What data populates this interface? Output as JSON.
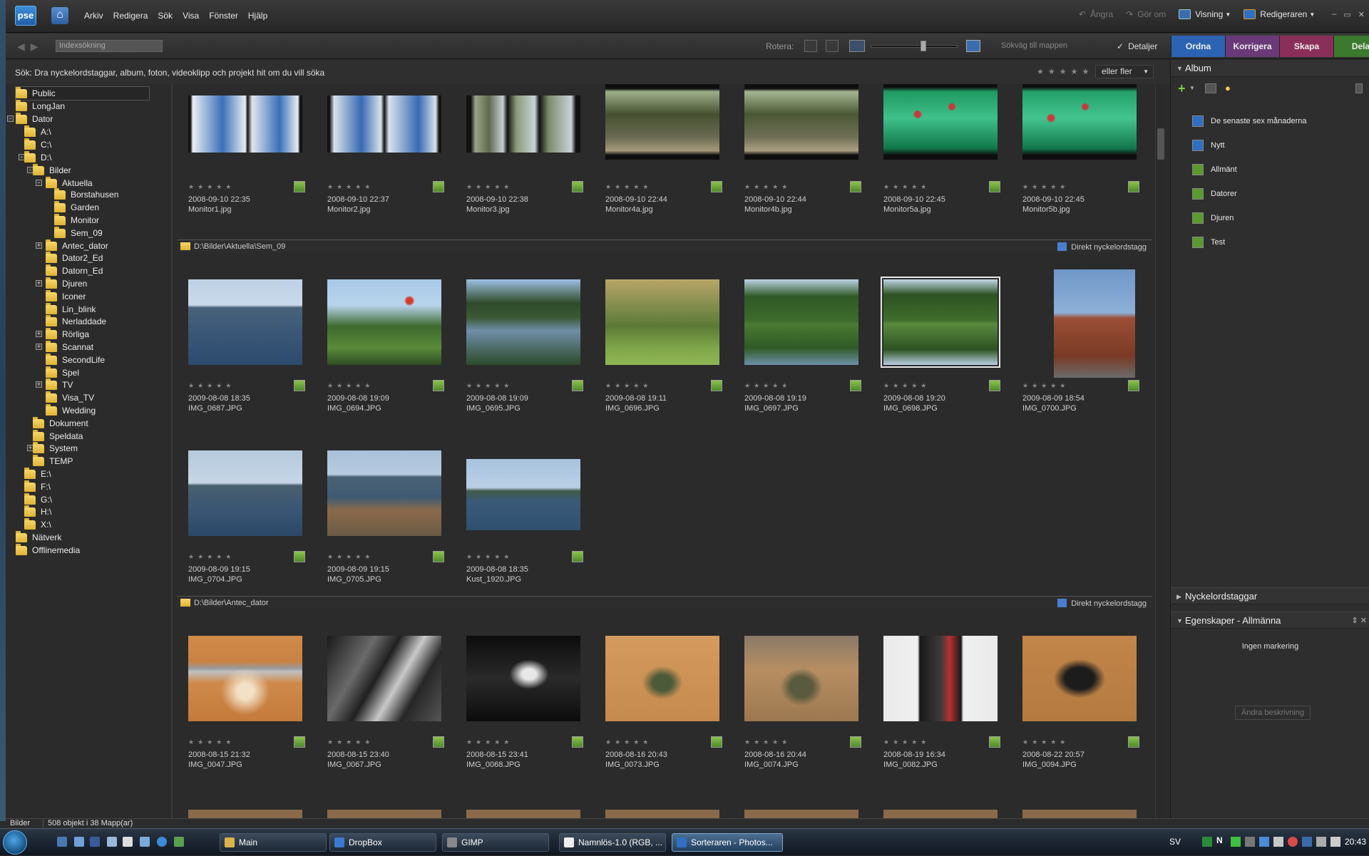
{
  "app": {
    "logo": "pse"
  },
  "menu": [
    "Arkiv",
    "Redigera",
    "Sök",
    "Visa",
    "Fönster",
    "Hjälp"
  ],
  "actions": {
    "undo": "Ångra",
    "redo": "Gör om",
    "view": "Visning",
    "editor": "Redigeraren"
  },
  "toolbar": {
    "search_placeholder": "Indexsökning",
    "rotate_label": "Rotera:",
    "path_select": "Sökväg till mappen",
    "details": "Detaljer"
  },
  "tabs": [
    {
      "label": "Ordna",
      "color": "#2d63b3"
    },
    {
      "label": "Korrigera",
      "color": "#6a3a78"
    },
    {
      "label": "Skapa",
      "color": "#8a2f5a"
    },
    {
      "label": "Dela",
      "color": "#3b7a2e"
    }
  ],
  "hint": "Sök: Dra nyckelordstaggar, album, foton, videoklipp och projekt hit om du vill söka",
  "rating_filter": "eller fler",
  "tree": [
    {
      "label": "Public",
      "level": 0,
      "toggle": "",
      "sel": true
    },
    {
      "label": "LongJan",
      "level": 0,
      "toggle": ""
    },
    {
      "label": "Dator",
      "level": 0,
      "toggle": "-"
    },
    {
      "label": "A:\\",
      "level": 1,
      "toggle": ""
    },
    {
      "label": "C:\\",
      "level": 1,
      "toggle": ""
    },
    {
      "label": "D:\\",
      "level": 1,
      "toggle": "-"
    },
    {
      "label": "Bilder",
      "level": 2,
      "toggle": "-"
    },
    {
      "label": "Aktuella",
      "level": 3,
      "toggle": "-"
    },
    {
      "label": "Borstahusen",
      "level": 4,
      "toggle": "",
      "small": true
    },
    {
      "label": "Garden",
      "level": 4,
      "toggle": "",
      "small": true
    },
    {
      "label": "Monitor",
      "level": 4,
      "toggle": "",
      "small": true
    },
    {
      "label": "Sem_09",
      "level": 4,
      "toggle": "",
      "small": true
    },
    {
      "label": "Antec_dator",
      "level": 3,
      "toggle": "+",
      "small": true
    },
    {
      "label": "Dator2_Ed",
      "level": 3,
      "toggle": "",
      "small": true
    },
    {
      "label": "Datorn_Ed",
      "level": 3,
      "toggle": "",
      "small": true
    },
    {
      "label": "Djuren",
      "level": 3,
      "toggle": "+",
      "small": true
    },
    {
      "label": "Iconer",
      "level": 3,
      "toggle": "",
      "small": true
    },
    {
      "label": "Lin_blink",
      "level": 3,
      "toggle": "",
      "small": true
    },
    {
      "label": "Nerladdade",
      "level": 3,
      "toggle": "",
      "small": true
    },
    {
      "label": "Rörliga",
      "level": 3,
      "toggle": "+",
      "small": true
    },
    {
      "label": "Scannat",
      "level": 3,
      "toggle": "+",
      "small": true
    },
    {
      "label": "SecondLife",
      "level": 3,
      "toggle": "",
      "small": true
    },
    {
      "label": "Spel",
      "level": 3,
      "toggle": "",
      "small": true
    },
    {
      "label": "TV",
      "level": 3,
      "toggle": "+",
      "small": true
    },
    {
      "label": "Visa_TV",
      "level": 3,
      "toggle": "",
      "small": true
    },
    {
      "label": "Wedding",
      "level": 3,
      "toggle": "",
      "small": true
    },
    {
      "label": "Dokument",
      "level": 2,
      "toggle": ""
    },
    {
      "label": "Speldata",
      "level": 2,
      "toggle": ""
    },
    {
      "label": "System",
      "level": 2,
      "toggle": "+"
    },
    {
      "label": "TEMP",
      "level": 2,
      "toggle": ""
    },
    {
      "label": "E:\\",
      "level": 1,
      "toggle": ""
    },
    {
      "label": "F:\\",
      "level": 1,
      "toggle": ""
    },
    {
      "label": "G:\\",
      "level": 1,
      "toggle": ""
    },
    {
      "label": "H:\\",
      "level": 1,
      "toggle": ""
    },
    {
      "label": "X:\\",
      "level": 1,
      "toggle": ""
    },
    {
      "label": "Nätverk",
      "level": 0,
      "toggle": ""
    },
    {
      "label": "Offlinemedia",
      "level": 0,
      "toggle": ""
    }
  ],
  "groups": [
    {
      "path": "D:\\Bilder\\Aktuella\\Sem_09",
      "tag": "Direkt nyckelordstagg"
    },
    {
      "path": "D:\\Bilder\\Antec_dator",
      "tag": "Direkt nyckelordstagg"
    }
  ],
  "photos": [
    {
      "date": "2008-09-10 22:35",
      "name": "Monitor1.jpg",
      "bg": "linear-gradient(90deg,#111 2%,#e8eef5 4%,#3a6fb8 30%,#e6ecf2 50%,#111 52%,#dfe6ee 56%,#3a6fb8 80%,#e6ecf2 96%,#111 98%)",
      "tall": false,
      "sel": false
    },
    {
      "date": "2008-09-10 22:37",
      "name": "Monitor2.jpg",
      "bg": "linear-gradient(90deg,#111 2%,#d9e2ec 6%,#3769b2 30%,#d9e2ec 47%,#111 50%,#d9e2ec 54%,#3769b2 80%,#d9e2ec 95%,#111 98%)",
      "tall": false,
      "sel": false
    },
    {
      "date": "2008-09-10 22:38",
      "name": "Monitor3.jpg",
      "bg": "linear-gradient(90deg,#111 4%,#9aa38a 8%,#5e6a4a 20%,#c7cfd3 32%,#111 36%,#8b9a7a 44%,#c9d2d8 60%,#111 64%,#7a8a6a 72%,#c9d2d8 92%,#111 96%)",
      "tall": false,
      "sel": false
    },
    {
      "date": "2008-09-10 22:44",
      "name": "Monitor4a.jpg",
      "bg": "linear-gradient(180deg,#0e0e0e 6%,#9fb08a 10%,#45502f 40%,#6a6a52 70%,#a59a7a 88%,#0e0e0e 94%)",
      "tall": false,
      "sel": false
    },
    {
      "date": "2008-09-10 22:44",
      "name": "Monitor4b.jpg",
      "bg": "linear-gradient(180deg,#0e0e0e 6%,#a6b691 10%,#4a5734 40%,#6f6f56 70%,#ab9e80 88%,#0e0e0e 94%)",
      "tall": false,
      "sel": false
    },
    {
      "date": "2008-09-10 22:45",
      "name": "Monitor5a.jpg",
      "bg": "radial-gradient(circle at 30% 40%,#c83a3a 3%,transparent 5%),radial-gradient(circle at 60% 30%,#c83a3a 3%,transparent 5%),linear-gradient(180deg,#0e0e0e 4%,#1f9a63 10%,#3fc08a 45%,#11774a 85%,#0e0e0e 94%)",
      "tall": false,
      "sel": false
    },
    {
      "date": "2008-09-10 22:45",
      "name": "Monitor5b.jpg",
      "bg": "radial-gradient(circle at 25% 45%,#c83a3a 3%,transparent 5%),radial-gradient(circle at 55% 30%,#c83a3a 3%,transparent 5%),linear-gradient(180deg,#0e0e0e 4%,#24a06a 10%,#44c48f 45%,#12784b 85%,#0e0e0e 94%)",
      "tall": false,
      "sel": false
    },
    {
      "date": "2009-08-08 18:35",
      "name": "IMG_0687.JPG",
      "bg": "linear-gradient(180deg,#bfd2e6 0%,#c9d9ea 30%,#49627a 33%,#3b5878 60%,#2d4b6d 100%)",
      "tall": false,
      "sel": false
    },
    {
      "date": "2009-08-08 19:09",
      "name": "IMG_0694.JPG",
      "bg": "radial-gradient(circle at 72% 25%,#d63b2a 3%,transparent 5%),linear-gradient(180deg,#a9c8e6 0%,#b8d4ec 30%,#3e6a2e 55%,#5a8a3a 80%,#2e4d24 100%)",
      "tall": false,
      "sel": false
    },
    {
      "date": "2009-08-08 19:09",
      "name": "IMG_0695.JPG",
      "bg": "linear-gradient(180deg,#9dbfe2 0%,#2e4a28 28%,#3c5a38 45%,#6f8fa8 60%,#2d4a2a 100%)",
      "tall": false,
      "sel": false
    },
    {
      "date": "2009-08-08 19:11",
      "name": "IMG_0696.JPG",
      "bg": "linear-gradient(180deg,#b9a567 0%,#7b8a4a 35%,#5c7a36 55%,#7fa64a 80%,#8fb554 100%)",
      "tall": false,
      "sel": false
    },
    {
      "date": "2009-08-08 19:19",
      "name": "IMG_0697.JPG",
      "bg": "linear-gradient(180deg,#bcd2e4 0%,#2f5a26 20%,#3d6a2c 48%,#4a7a32 52%,#2f5a26 80%,#6e90a8 100%)",
      "tall": false,
      "sel": false
    },
    {
      "date": "2009-08-08 19:20",
      "name": "IMG_0698.JPG",
      "bg": "linear-gradient(180deg,#c2d6e6 0%,#2c5222 18%,#416f2c 48%,#5a8a3e 52%,#2c5222 82%,#b9cde0 100%)",
      "tall": false,
      "sel": true
    },
    {
      "date": "2009-08-09 18:54",
      "name": "IMG_0700.JPG",
      "bg": "linear-gradient(180deg,#6f97c8 0%,#8eb0d8 40%,#9b4f36 45%,#7a3a26 80%,#6b6b6b 100%)",
      "tall": true,
      "sel": false
    },
    {
      "date": "2009-08-09 19:15",
      "name": "IMG_0704.JPG",
      "bg": "linear-gradient(180deg,#b5c9dc 0%,#c6d6e6 38%,#4a6070 41%,#3a5674 70%,#2c4868 100%)",
      "tall": false,
      "sel": false
    },
    {
      "date": "2009-08-09 19:15",
      "name": "IMG_0705.JPG",
      "bg": "linear-gradient(180deg,#a8c0d8 0%,#b7cbe0 28%,#4a6274 31%,#3f5a74 55%,#8a6a4a 70%,#6a5a46 100%)",
      "tall": false,
      "sel": false
    },
    {
      "date": "2009-08-08 18:35",
      "name": "Kust_1920.JPG",
      "bg": "linear-gradient(180deg,#a9c3de 0%,#b9cfe6 40%,#3e5a46 45%,#3b5a7a 60%,#30506f 100%)",
      "tall": false,
      "sel": false,
      "short": true
    },
    {
      "date": "2008-08-15 21:32",
      "name": "IMG_0047.JPG",
      "bg": "radial-gradient(ellipse at 50% 65%,#f3e0c6 10%,transparent 30%),linear-gradient(180deg,#d08a48 0%,#c98243 30%,#9a9a9a 38%,#c0c0c0 42%,#cf8a4b 55%,#c47a3a 100%)",
      "tall": false,
      "sel": false
    },
    {
      "date": "2008-08-15 23:40",
      "name": "IMG_0067.JPG",
      "bg": "linear-gradient(120deg,#1a1a1a 0%,#6a6a6a 30%,#202020 45%,#c9c9c9 60%,#262626 75%,#555 100%)",
      "tall": false,
      "sel": false
    },
    {
      "date": "2008-08-15 23:41",
      "name": "IMG_0068.JPG",
      "bg": "radial-gradient(ellipse at 55% 45%,#e8e8e8 8%,transparent 22%),linear-gradient(180deg,#0c0c0c 0%,#2a2a2a 50%,#0c0c0c 100%)",
      "tall": false,
      "sel": false
    },
    {
      "date": "2008-08-16 20:43",
      "name": "IMG_0073.JPG",
      "bg": "radial-gradient(ellipse at 50% 55%,#4d5a3a 12%,transparent 25%),linear-gradient(180deg,#d49a5e 0%,#c58a4e 100%)",
      "tall": false,
      "sel": false
    },
    {
      "date": "2008-08-16 20:44",
      "name": "IMG_0074.JPG",
      "bg": "radial-gradient(ellipse at 50% 60%,#5a5a3e 14%,transparent 26%),linear-gradient(180deg,#8a7a68 0%,#b78e62 40%,#9c7850 100%)",
      "tall": false,
      "sel": false
    },
    {
      "date": "2008-08-19 16:34",
      "name": "IMG_0082.JPG",
      "bg": "linear-gradient(90deg,#e9e9e9 0%,#f0f0f0 30%,#1a1a1a 32%,#3a3a3a 50%,#b83030 58%,#1a1a1a 68%,#f0f0f0 70%,#e9e9e9 100%)",
      "tall": false,
      "sel": false
    },
    {
      "date": "2008-08-22 20:57",
      "name": "IMG_0094.JPG",
      "bg": "radial-gradient(ellipse at 50% 50%,#1c1c1c 18%,transparent 32%),linear-gradient(180deg,#c2854a 0%,#b47a40 100%)",
      "tall": false,
      "sel": false
    }
  ],
  "right": {
    "album_header": "Album",
    "albums": [
      {
        "label": "De senaste sex månaderna",
        "color": "#2f6fc6"
      },
      {
        "label": "Nytt",
        "color": "#2f6fc6"
      },
      {
        "label": "Allmänt",
        "color": "#5a9a2e"
      },
      {
        "label": "Datorer",
        "color": "#5a9a2e"
      },
      {
        "label": "Djuren",
        "color": "#5a9a2e"
      },
      {
        "label": "Test",
        "color": "#5a9a2e"
      }
    ],
    "keywords_header": "Nyckelordstaggar",
    "props_header": "Egenskaper - Allmänna",
    "no_selection": "Ingen markering",
    "change_desc": "Ändra beskrivning"
  },
  "status": {
    "location": "Bilder",
    "count": "508 objekt i 38 Mapp(ar)"
  },
  "taskbar": {
    "buttons": [
      {
        "label": "Main",
        "color": "#d8b44a"
      },
      {
        "label": "DropBox",
        "color": "#3a7ad0"
      },
      {
        "label": "GIMP",
        "color": "#888"
      },
      {
        "label": "Namnlös-1.0 (RGB, ...",
        "color": "#eee"
      },
      {
        "label": "Sorteraren - Photos...",
        "color": "#2f6fc6",
        "active": true
      }
    ],
    "lang": "SV",
    "clock": "20:43"
  }
}
